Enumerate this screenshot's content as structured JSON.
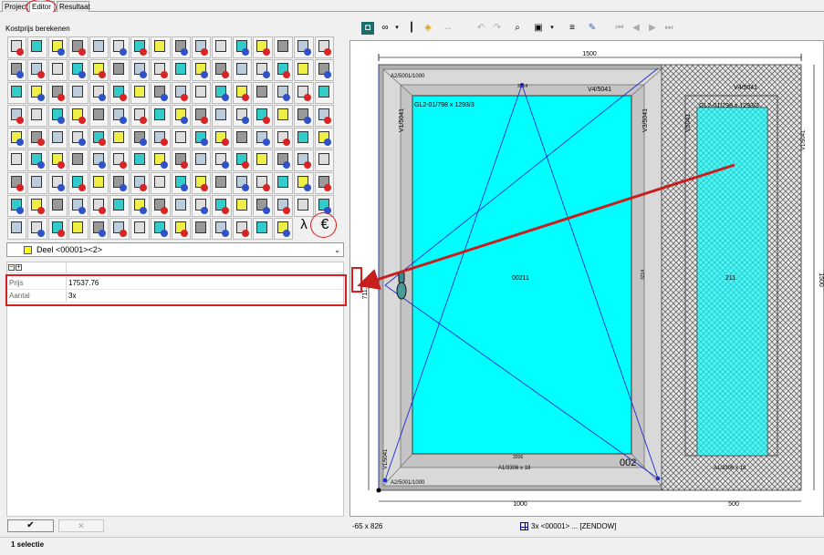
{
  "tabs": [
    {
      "label": "Project"
    },
    {
      "label": "Editor"
    },
    {
      "label": "Resultaat"
    }
  ],
  "left": {
    "title": "Kostprijs berekenen",
    "lambda_label": "λ",
    "euro_label": "€",
    "dropdown": {
      "value": "Deel <00001><2>",
      "arrow": "⌄"
    },
    "props": [
      {
        "key": "Prijs",
        "value": "17537.76"
      },
      {
        "key": "Aantal",
        "value": "3x"
      }
    ],
    "ok_label": "✔",
    "cancel_label": "✕"
  },
  "status": {
    "text": "1 selectie"
  },
  "coord_bar": {
    "coords": "-65 x 826",
    "ident": "3x <00001> ... [ZENDOW]"
  },
  "drawing": {
    "dims": {
      "top_total": "1500",
      "bottom_left": "1000",
      "bottom_right": "500",
      "right_total": "1500",
      "left_dim": "711.5"
    },
    "labels": {
      "top_left_profile": "A2/5001/1000",
      "top_right_profile": "V4/5041",
      "left_profile": "V1/5041",
      "right_profile": "V3/5041",
      "top_dim_small": "3214",
      "right_dim_small": "3214",
      "glass_left": "GL2-01/798 x 1293/3",
      "glass_right": "GL2-01/298 x 1293/3",
      "sash_center": "00211",
      "sash_center_right": "211",
      "sash_number": "002",
      "bottom_profile": "A1/3306 x 18",
      "bottom_profile2": "A2/5001/1000",
      "fixed_left": "V5041",
      "fixed_right": "V4/5041",
      "fixed_bottom": "A1/3306 x 18",
      "bottom_dim_small": "3206",
      "right_side": "V1/5041",
      "left_side_bottom": "V1/5041"
    }
  },
  "colors": {
    "glass": "#00ffff",
    "frame": "#b0b0b0",
    "highlight_red": "#d81e1e",
    "dim_line": "#0000a0"
  },
  "icons": {
    "toolbar": [
      "zoom-icon",
      "glasses-icon",
      "hinge-icon",
      "layers-icon",
      "dim-icon",
      "undo-icon",
      "redo-icon",
      "zoom-window-icon",
      "select-icon",
      "align-icon",
      "wand-icon",
      "first-icon",
      "prev-icon",
      "next-icon",
      "last-icon"
    ]
  }
}
